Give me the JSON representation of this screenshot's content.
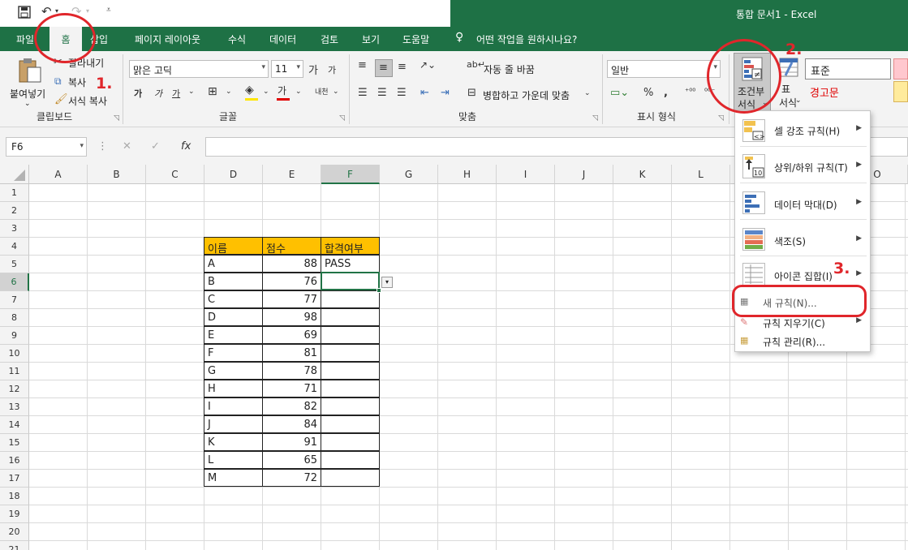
{
  "window": {
    "title": "통합 문서1  -  Excel"
  },
  "tabs": [
    "파일",
    "홈",
    "삽입",
    "페이지 레이아웃",
    "수식",
    "데이터",
    "검토",
    "보기",
    "도움말"
  ],
  "tell_me": "어떤 작업을 원하시나요?",
  "ribbon": {
    "clipboard": {
      "paste": "붙여넣기",
      "cut": "잘라내기",
      "copy": "복사",
      "format_painter": "서식 복사",
      "group": "클립보드"
    },
    "font": {
      "name": "맑은 고딕",
      "size": "11",
      "bold": "가",
      "italic": "가",
      "underline": "가",
      "grow": "가",
      "shrink": "가",
      "phonetic": "내천",
      "font_color": "가",
      "group": "글꼴"
    },
    "alignment": {
      "wrap": "자동 줄 바꿈",
      "merge": "병합하고 가운데 맞춤",
      "group": "맞춤"
    },
    "number": {
      "format": "일반",
      "percent": "%",
      "group": "표시 형식"
    },
    "styles": {
      "cond_format_line1": "조건부",
      "cond_format_line2": "서식",
      "table_line1": "표",
      "table_line2": "서식",
      "style_normal": "표준",
      "style_warning": "경고문"
    }
  },
  "formula_bar": {
    "name_box": "F6",
    "fx": "fx",
    "formula": ""
  },
  "columns": [
    "A",
    "B",
    "C",
    "D",
    "E",
    "F",
    "G",
    "H",
    "I",
    "J",
    "K",
    "L",
    "M",
    "",
    "O"
  ],
  "rows": [
    "1",
    "2",
    "3",
    "4",
    "5",
    "6",
    "7",
    "8",
    "9",
    "10",
    "11",
    "12",
    "13",
    "14",
    "15",
    "16",
    "17",
    "18",
    "19",
    "20",
    "21"
  ],
  "selected_cell": "F6",
  "table": {
    "headers": [
      "이름",
      "점수",
      "합격여부"
    ],
    "rows": [
      [
        "A",
        "88",
        "PASS"
      ],
      [
        "B",
        "76",
        ""
      ],
      [
        "C",
        "77",
        ""
      ],
      [
        "D",
        "98",
        ""
      ],
      [
        "E",
        "69",
        ""
      ],
      [
        "F",
        "81",
        ""
      ],
      [
        "G",
        "78",
        ""
      ],
      [
        "H",
        "71",
        ""
      ],
      [
        "I",
        "82",
        ""
      ],
      [
        "J",
        "84",
        ""
      ],
      [
        "K",
        "91",
        ""
      ],
      [
        "L",
        "65",
        ""
      ],
      [
        "M",
        "72",
        ""
      ]
    ],
    "header_color": "#FFC000"
  },
  "cond_menu": {
    "items": [
      {
        "label": "셀 강조 규칙(H)",
        "icon": "highlight-cells-icon"
      },
      {
        "label": "상위/하위 규칙(T)",
        "icon": "top-bottom-icon"
      },
      {
        "label": "데이터 막대(D)",
        "icon": "data-bars-icon"
      },
      {
        "label": "색조(S)",
        "icon": "color-scales-icon"
      },
      {
        "label": "아이콘 집합(I)",
        "icon": "icon-sets-icon"
      }
    ],
    "new_rule": "새 규칙(N)...",
    "clear_rules": "규칙 지우기(C)",
    "manage_rules": "규칙 관리(R)..."
  },
  "annotations": {
    "step1": "1.",
    "step2": "2.",
    "step3": "3.",
    "color": "#E0262B"
  }
}
